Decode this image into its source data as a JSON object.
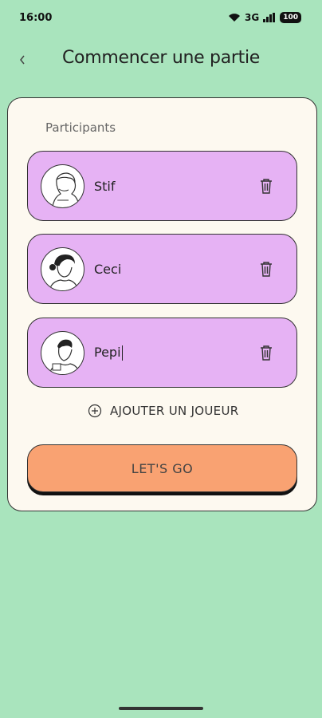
{
  "status_bar": {
    "time": "16:00",
    "network": "3G",
    "battery": "100"
  },
  "header": {
    "title": "Commencer une partie",
    "back_icon": "chevron-left-icon"
  },
  "card": {
    "section_label": "Participants",
    "players": [
      {
        "name": "Stif",
        "avatar": "avatar-man-icon"
      },
      {
        "name": "Ceci",
        "avatar": "avatar-woman-icon"
      },
      {
        "name": "Pepi",
        "avatar": "avatar-boy-icon"
      }
    ],
    "add_player_label": "AJOUTER UN JOUEUR",
    "start_label": "LET'S GO"
  },
  "colors": {
    "background": "#a9e4bd",
    "card": "#fdf9f0",
    "player_card": "#e6b2f4",
    "start_button": "#f9a272"
  }
}
